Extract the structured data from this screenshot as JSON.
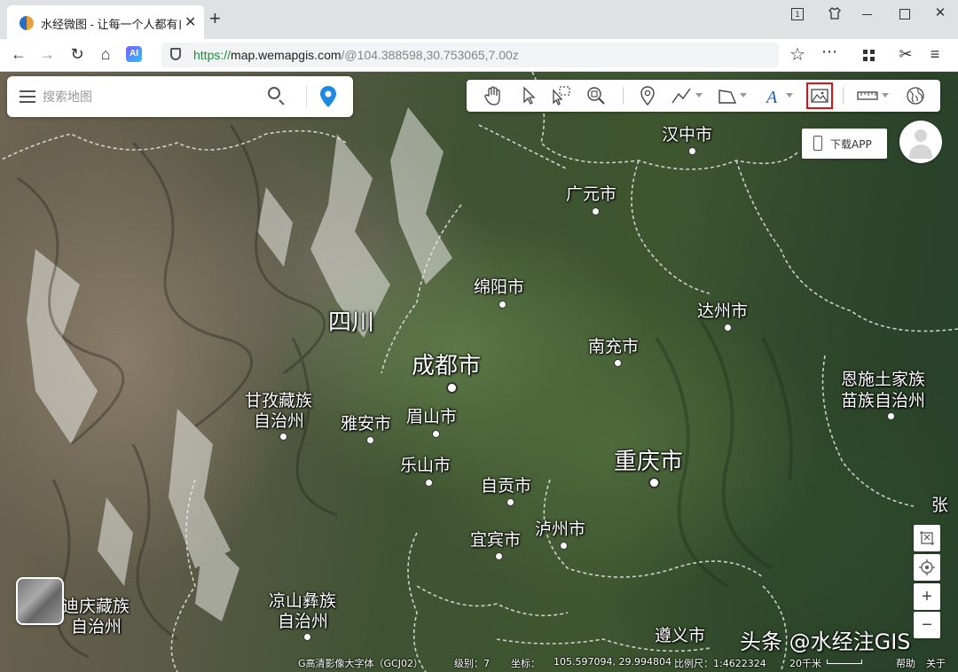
{
  "browser": {
    "tab_title": "水经微图 - 让每一个人都有自",
    "tab_close": "✕",
    "new_tab": "+",
    "window_controls": [
      "⧉",
      "👕",
      "—",
      "☐",
      "✕"
    ],
    "url_protocol": "https://",
    "url_host": "map.wemapgis.com",
    "url_path": "/@104.388598,30.753065,7.00z",
    "ai_badge": "AI",
    "nav_back": "←",
    "nav_forward": "→",
    "nav_reload": "↻",
    "nav_home": "⌂",
    "bookmark": "☆",
    "more": "⋯",
    "extensions": "▦",
    "scissors": "✂",
    "menu": "≡"
  },
  "search": {
    "placeholder": "搜索地图"
  },
  "toolbar": {
    "tools": [
      "hand-icon",
      "pointer-icon",
      "select-box-icon",
      "zoom-box-icon",
      "marker-icon",
      "polyline-icon",
      "polygon-icon",
      "text-icon",
      "image-icon",
      "ruler-icon",
      "globe-icon"
    ]
  },
  "download_app": {
    "label": "下载APP"
  },
  "map_controls": {
    "zoom_in": "+",
    "zoom_out": "−"
  },
  "labels": {
    "hanzhong": "汉中市",
    "guangyuan": "广元市",
    "mianyang": "绵阳市",
    "sichuan": "四川",
    "chengdu": "成都市",
    "dazhou": "达州市",
    "nanchong": "南充市",
    "enshi_1": "恩施土家族",
    "enshi_2": "苗族自治州",
    "ganzi_1": "甘孜藏族",
    "ganzi_2": "自治州",
    "yaan": "雅安市",
    "meishan": "眉山市",
    "leshan": "乐山市",
    "chongqing": "重庆市",
    "zigong": "自贡市",
    "zhang": "张",
    "luzhou": "泸州市",
    "yibin": "宜宾市",
    "diqing_1": "迪庆藏族",
    "diqing_2": "自治州",
    "liangshan_1": "凉山彝族",
    "liangshan_2": "自治州",
    "zunyi": "遵义市"
  },
  "status": {
    "layer": "G高清影像大字体（GCJ02）",
    "level_label": "级别：7",
    "coord_label": "坐标：",
    "coord_value": "105.597094, 29.994804",
    "scale_label": "比例尺：1:4622324",
    "scale_distance": "20千米",
    "help": "帮助",
    "about": "关于"
  },
  "watermark": "头条 @水经注GIS",
  "colors": {
    "url_green": "#1a8f3c",
    "pin_blue": "#1e88e5",
    "highlight_red": "#dd1111"
  }
}
